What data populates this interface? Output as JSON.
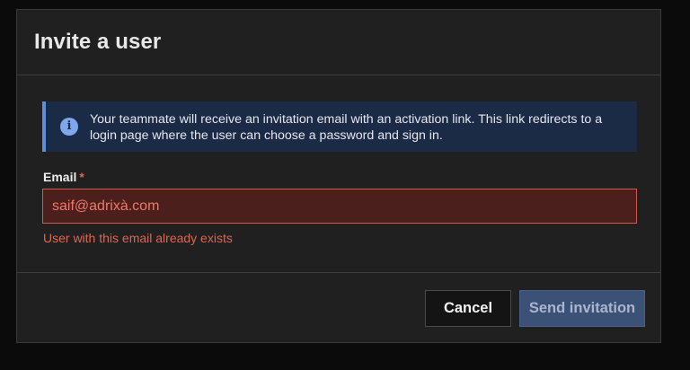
{
  "dialog": {
    "title": "Invite a user",
    "info_message": "Your teammate will receive an invitation email with an activation link. This link redirects to a login page where the user can choose a password and sign in.",
    "info_icon": "info-icon",
    "email": {
      "label": "Email",
      "required_marker": "*",
      "value": "saif@adrixà.com",
      "error": "User with this email already exists"
    },
    "buttons": {
      "cancel": "Cancel",
      "send": "Send invitation"
    }
  },
  "colors": {
    "background": "#0b0b0b",
    "dialog_bg": "#202020",
    "info_bg": "#1c2b45",
    "info_accent": "#5b8fd9",
    "error": "#e0654f",
    "primary_button": "#3c5176"
  }
}
